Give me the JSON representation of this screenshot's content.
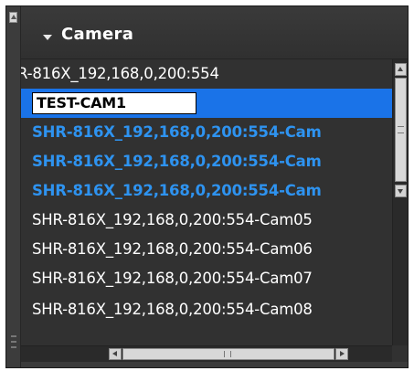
{
  "panel": {
    "title": "Camera"
  },
  "camera_list": {
    "rows": [
      {
        "label": "R-816X_192,168,0,200:554",
        "state": "normal"
      },
      {
        "label": "TEST-CAM1",
        "state": "editing"
      },
      {
        "label": "SHR-816X_192,168,0,200:554-Cam",
        "state": "selected"
      },
      {
        "label": "SHR-816X_192,168,0,200:554-Cam",
        "state": "selected"
      },
      {
        "label": "SHR-816X_192,168,0,200:554-Cam",
        "state": "selected"
      },
      {
        "label": "SHR-816X_192,168,0,200:554-Cam05",
        "state": "normal"
      },
      {
        "label": "SHR-816X_192,168,0,200:554-Cam06",
        "state": "normal"
      },
      {
        "label": "SHR-816X_192,168,0,200:554-Cam07",
        "state": "normal"
      },
      {
        "label": "SHR-816X_192,168,0,200:554-Cam08",
        "state": "normal"
      }
    ]
  },
  "colors": {
    "panel_bg": "#313131",
    "selected_text": "#2e93f0",
    "edit_row_bg": "#1a73e8",
    "normal_text": "#ffffff"
  },
  "icons": {
    "header_toggle": "caret-down-icon",
    "scroll_up": "arrow-up-icon",
    "scroll_down": "arrow-down-icon",
    "scroll_left": "arrow-left-icon",
    "scroll_right": "arrow-right-icon"
  }
}
